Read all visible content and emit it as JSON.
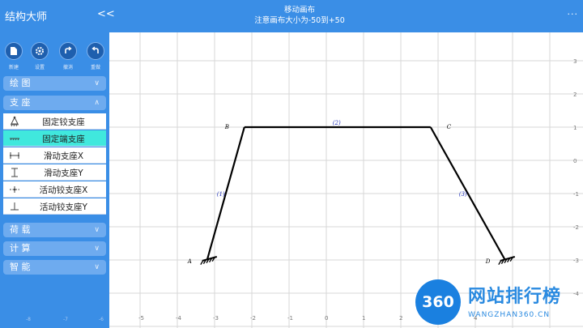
{
  "header": {
    "app_title": "结构大师",
    "collapse_label": "<<",
    "mode_title": "移动画布",
    "mode_hint": "注意画布大小为-50到+50",
    "more_label": "..."
  },
  "toolbar": [
    {
      "label": "新建",
      "icon": "new-file-icon"
    },
    {
      "label": "设置",
      "icon": "gear-icon"
    },
    {
      "label": "撤消",
      "icon": "undo-icon"
    },
    {
      "label": "重做",
      "icon": "redo-icon"
    }
  ],
  "sections": {
    "draw": "绘 图",
    "support": "支 座",
    "load": "荷 载",
    "compute": "计 算",
    "smart": "智 能"
  },
  "supports": [
    {
      "label": "固定铰支座",
      "icon": "pin-support-icon",
      "active": false
    },
    {
      "label": "固定端支座",
      "icon": "fixed-support-icon",
      "active": true
    },
    {
      "label": "滑动支座X",
      "icon": "slide-x-icon",
      "active": false
    },
    {
      "label": "滑动支座Y",
      "icon": "slide-y-icon",
      "active": false
    },
    {
      "label": "活动铰支座X",
      "icon": "roller-x-icon",
      "active": false
    },
    {
      "label": "活动铰支座Y",
      "icon": "roller-y-icon",
      "active": false
    }
  ],
  "canvas": {
    "x_ticks": [
      "-5",
      "-4",
      "-3",
      "-2",
      "-1",
      "0",
      "1",
      "2",
      "3",
      "4"
    ],
    "y_ticks": [
      "3",
      "2",
      "1",
      "0",
      "-1",
      "-2",
      "-3",
      "-4"
    ],
    "hidden_x_ticks": [
      "-8",
      "-7",
      "-6"
    ],
    "nodes": [
      {
        "name": "A",
        "x": -3.2,
        "y": -3
      },
      {
        "name": "B",
        "x": -2.2,
        "y": 1
      },
      {
        "name": "C",
        "x": 2.8,
        "y": 1
      },
      {
        "name": "D",
        "x": 4.8,
        "y": -3
      }
    ],
    "members": [
      {
        "label": "(1)",
        "from": 0,
        "to": 1
      },
      {
        "label": "(2)",
        "from": 1,
        "to": 2
      },
      {
        "label": "(3)",
        "from": 2,
        "to": 3
      }
    ],
    "fixed_supports": [
      0,
      3
    ]
  },
  "watermark": {
    "badge": "360",
    "text": "网站排行榜",
    "url": "WANGZHAN360.CN"
  }
}
